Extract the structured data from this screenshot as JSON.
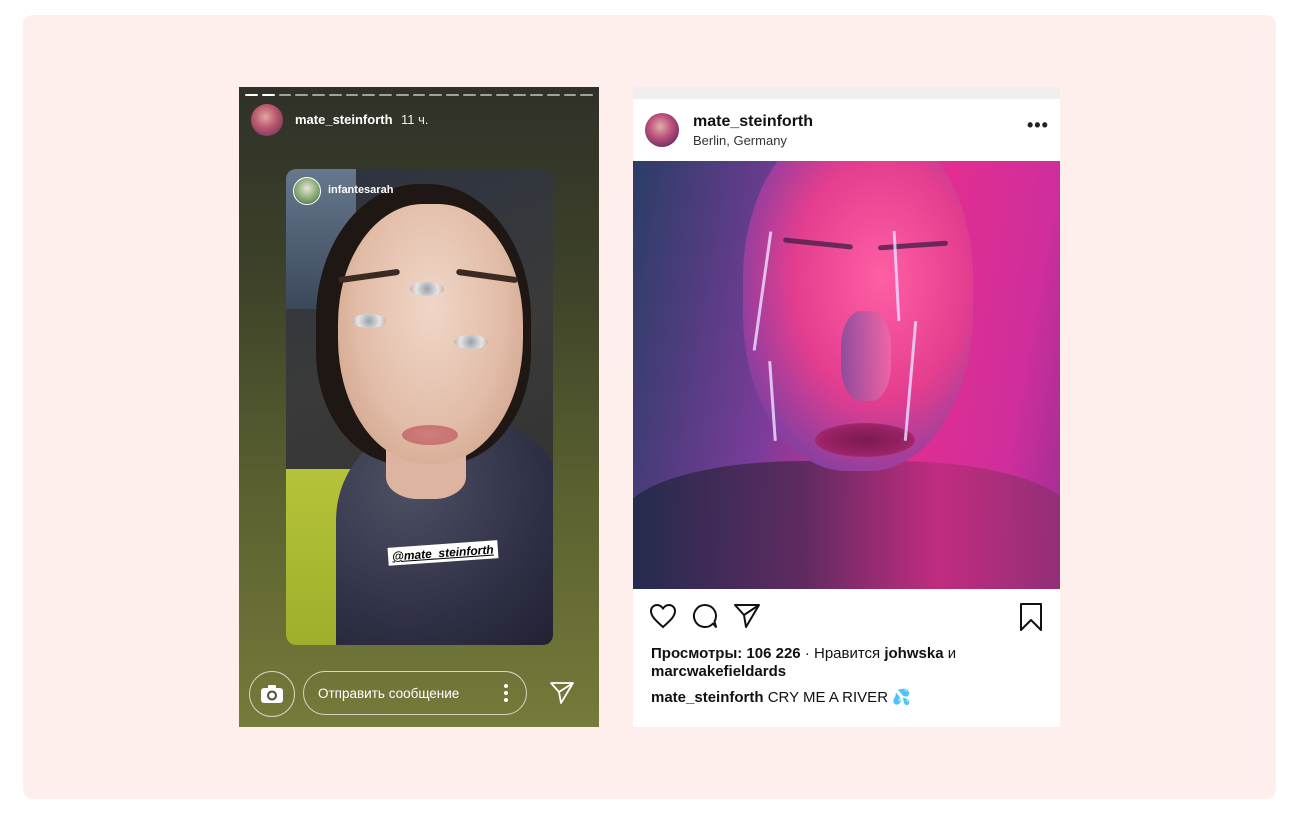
{
  "story": {
    "username": "mate_steinforth",
    "time": "11 ч.",
    "inner_username": "infantesarah",
    "mention": "@mate_steinforth",
    "message_placeholder": "Отправить сообщение"
  },
  "post": {
    "username": "mate_steinforth",
    "location": "Berlin, Germany",
    "more": "•••",
    "views_label": "Просмотры: 106 226",
    "likes_prefix": " · Нравится ",
    "liker_1": "johwska",
    "likes_joiner": " и",
    "liker_2": "marcwakefieldards",
    "caption_user": "mate_steinforth",
    "caption_text": " CRY ME A RIVER 💦"
  },
  "colors": {
    "background_card": "#feeeec",
    "accent_pink": "#e52d8f"
  }
}
